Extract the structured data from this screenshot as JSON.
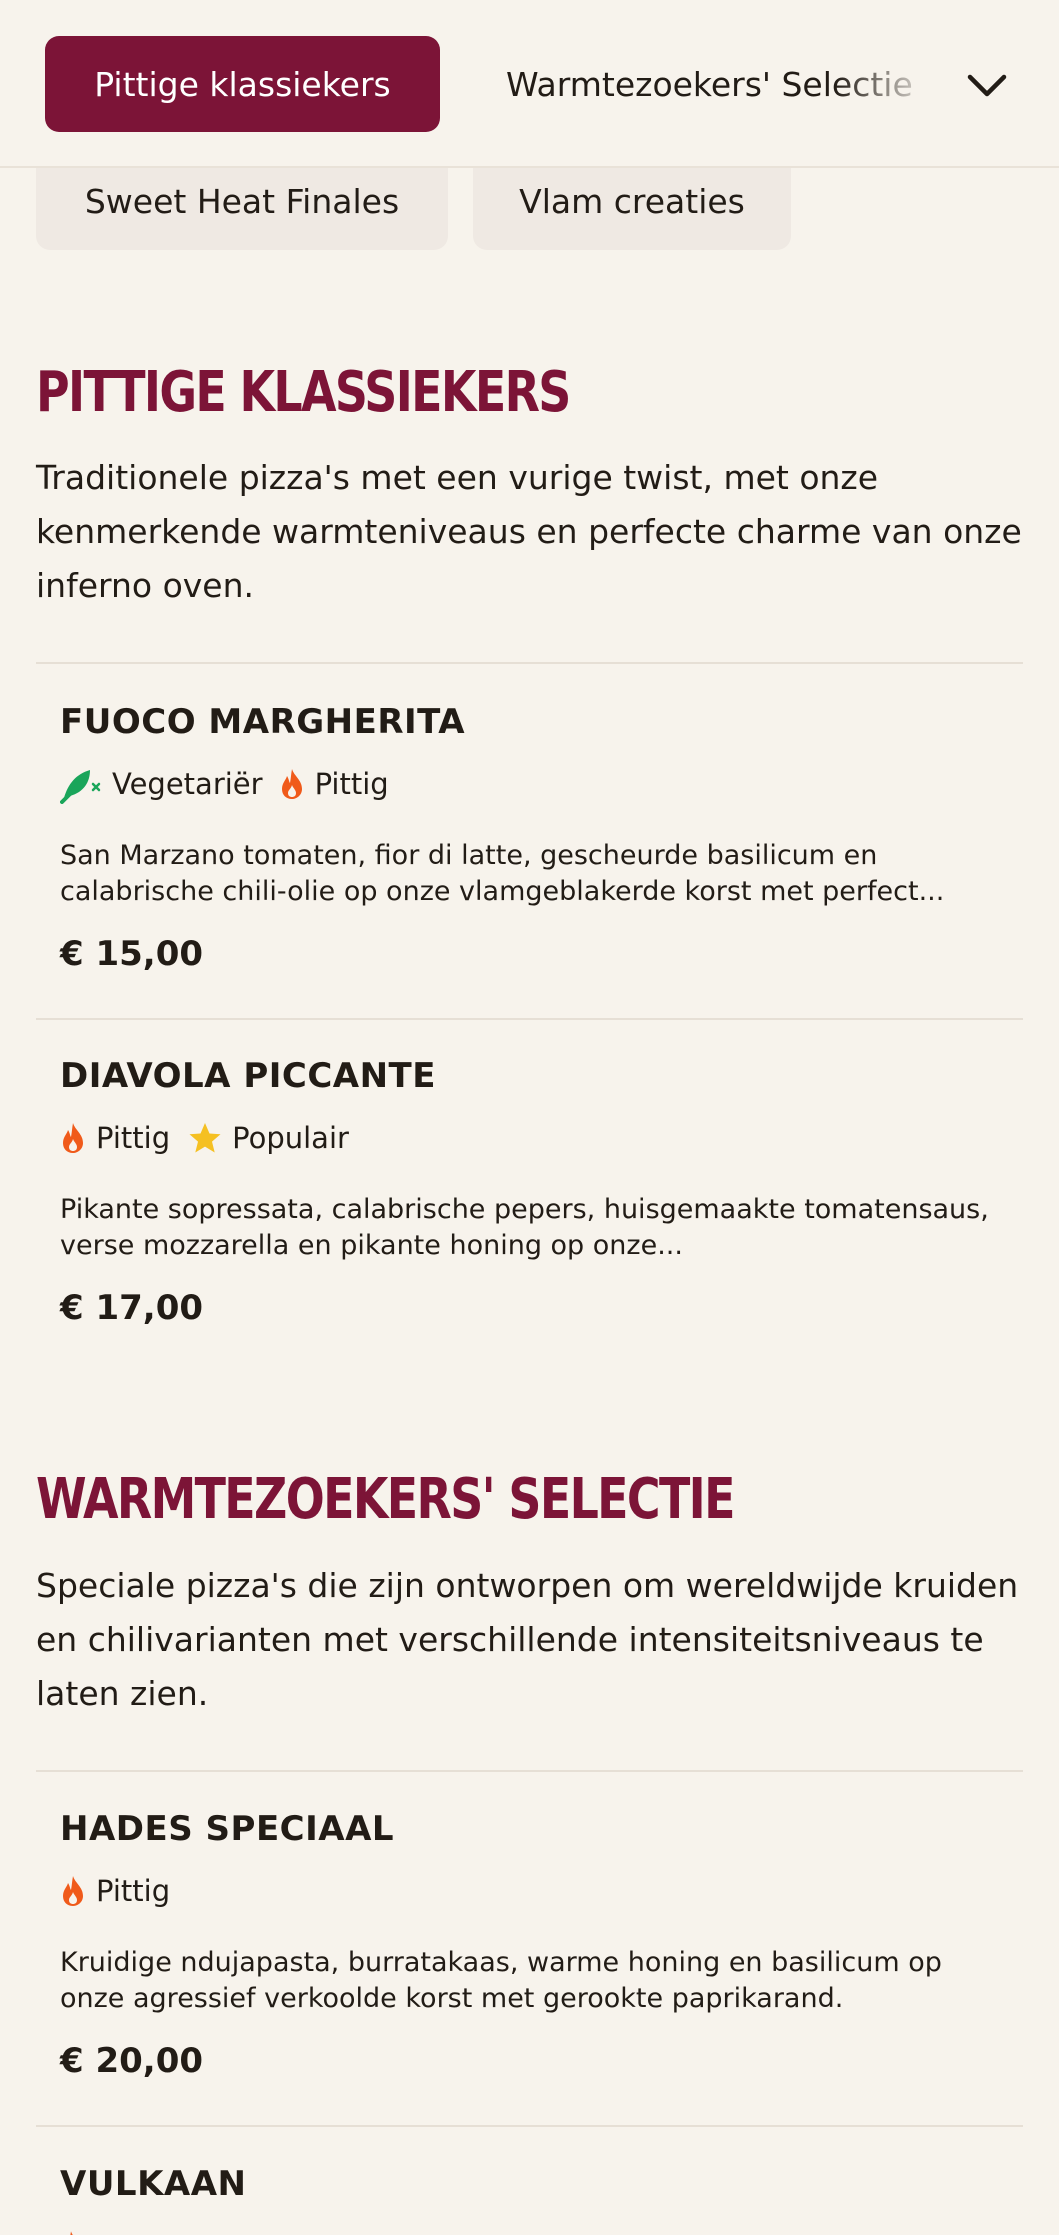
{
  "tabs": {
    "active": "Pittige klassiekers",
    "next": "Warmtezoekers' Selectie",
    "row2": [
      "Sweet Heat Finales",
      "Vlam creaties"
    ]
  },
  "colors": {
    "accent": "#7c1437",
    "background": "#f7f3ec",
    "pill": "#efe9e3",
    "spicy": "#f05a1a",
    "vegetarian": "#1aa55a",
    "popular": "#f5c022"
  },
  "sections": [
    {
      "title": "PITTIGE KLASSIEKERS",
      "description": "Traditionele pizza's met een vurige twist, met onze kenmerkende warmteniveaus en perfecte charme van onze inferno oven.",
      "items": [
        {
          "name": "FUOCO MARGHERITA",
          "tags": [
            "Vegetariër",
            "Pittig"
          ],
          "description": "San Marzano tomaten, fior di latte, gescheurde basilicum en calabrische chili-olie op onze vlamgeblakerde korst met perfect...",
          "price": "€ 15,00"
        },
        {
          "name": "DIAVOLA PICCANTE",
          "tags": [
            "Pittig",
            "Populair"
          ],
          "description": "Pikante sopressata, calabrische pepers, huisgemaakte tomatensaus, verse mozzarella en pikante honing op onze...",
          "price": "€ 17,00"
        }
      ]
    },
    {
      "title": "WARMTEZOEKERS' SELECTIE",
      "description": "Speciale pizza's die zijn ontworpen om wereldwijde kruiden en chilivarianten met verschillende intensiteitsniveaus te laten zien.",
      "items": [
        {
          "name": "HADES SPECIAAL",
          "tags": [
            "Pittig"
          ],
          "description": "Kruidige ndujapasta, burratakaas, warme honing en basilicum op onze agressief verkoolde korst met gerookte paprikarand.",
          "price": "€ 20,00"
        },
        {
          "name": "VULKAAN"
        }
      ]
    }
  ],
  "icons": {
    "vegetarian": "leaf-icon",
    "spicy": "flame-icon",
    "popular": "star-icon",
    "dropdown": "chevron-down-icon"
  }
}
